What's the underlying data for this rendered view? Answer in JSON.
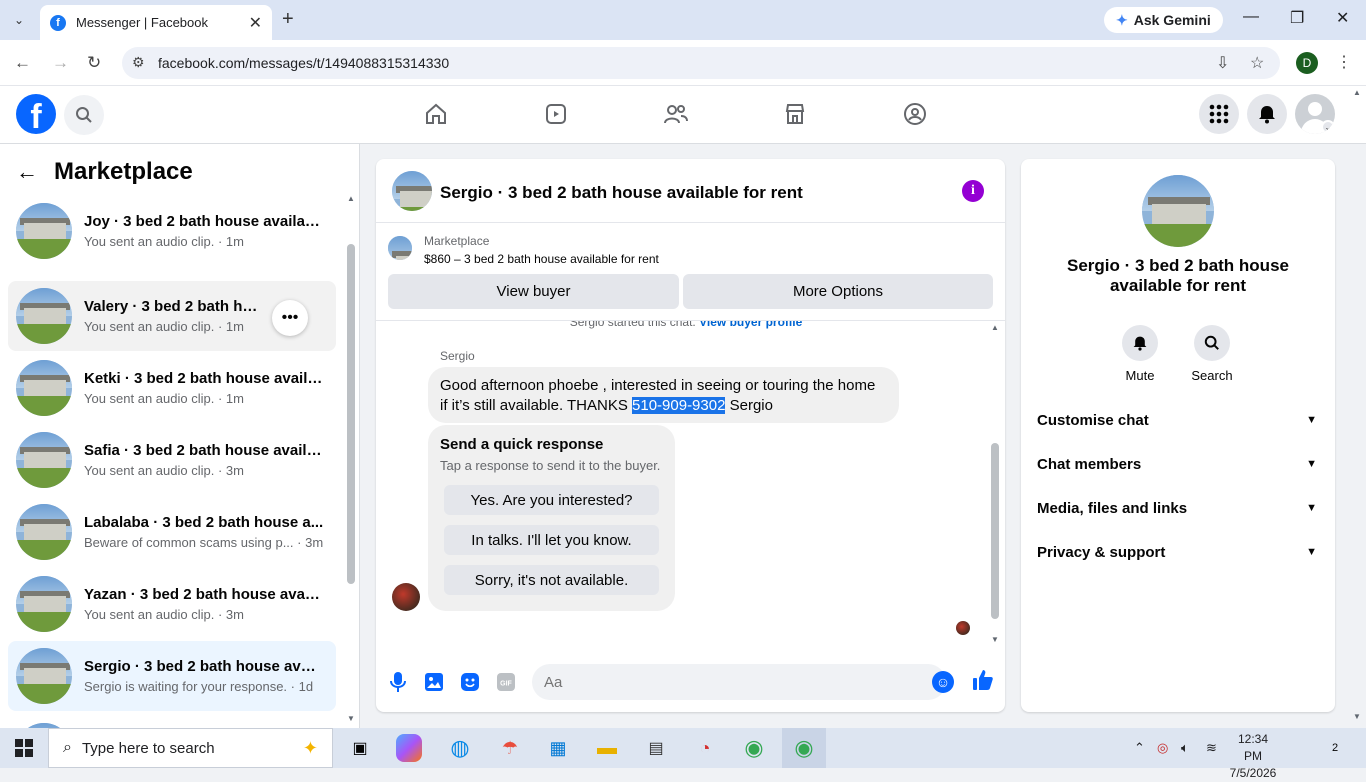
{
  "browser": {
    "tab_title": "Messenger | Facebook",
    "url": "facebook.com/messages/t/1494088315314330",
    "gemini_label": "Ask Gemini",
    "profile_initial": "D"
  },
  "left": {
    "title": "Marketplace",
    "chats": [
      {
        "name": "Joy · 3 bed 2 bath house availab...",
        "sub": "You sent an audio clip. · 1m"
      },
      {
        "name": "Valery · 3 bed 2 bath house av...",
        "sub": "You sent an audio clip. · 1m"
      },
      {
        "name": "Ketki · 3 bed 2 bath house availa...",
        "sub": "You sent an audio clip. · 1m"
      },
      {
        "name": "Safia · 3 bed 2 bath house availa...",
        "sub": "You sent an audio clip. · 3m"
      },
      {
        "name": "Labalaba · 3 bed 2 bath house a...",
        "sub": "Beware of common scams using p... · 3m"
      },
      {
        "name": "Yazan · 3 bed 2 bath house avail...",
        "sub": "You sent an audio clip. · 3m"
      },
      {
        "name": "Sergio · 3 bed 2 bath house avai...",
        "sub": "Sergio is waiting for your response. · 1d"
      }
    ]
  },
  "conversation": {
    "title": "Sergio · 3 bed 2 bath house available for rent",
    "listing_label": "Marketplace",
    "listing_price": "$860 – 3 bed 2 bath house available for rent",
    "view_buyer": "View buyer",
    "more_options": "More Options",
    "start_note": "Sergio started this chat.",
    "view_profile": "View buyer profile",
    "sender": "Sergio",
    "message_line1": "Good afternoon phoebe , interested in seeing or touring the home",
    "message_line2_a": "if it’s still available. THANKS ",
    "message_phone": "510-909-9302",
    "message_line2_b": " Sergio",
    "quick_title": "Send a quick response",
    "quick_sub": "Tap a response to send it to the buyer.",
    "quick_replies": [
      "Yes. Are you interested?",
      "In talks. I'll let you know.",
      "Sorry, it's not available."
    ],
    "input_placeholder": "Aa"
  },
  "details": {
    "title": "Sergio · 3 bed 2 bath house available for rent",
    "mute": "Mute",
    "search": "Search",
    "sections": [
      "Customise chat",
      "Chat members",
      "Media, files and links",
      "Privacy & support"
    ]
  },
  "taskbar": {
    "search_placeholder": "Type here to search",
    "time": "12:34 PM",
    "date": "7/5/2026",
    "notif_count": "2"
  },
  "colors": {
    "accent": "#0866ff",
    "info": "#9400d3",
    "highlight": "#1a73e8"
  }
}
